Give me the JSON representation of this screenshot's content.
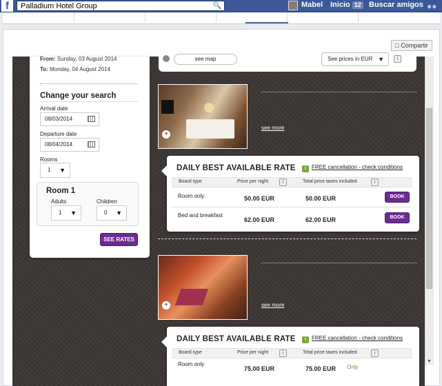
{
  "topbar": {
    "logo": "f",
    "search_value": "Palladium Hotel Group",
    "user_name": "Mabel",
    "home_label": "Inicio",
    "home_count": "12",
    "find_friends": "Buscar amigos"
  },
  "share_label": "Compartir",
  "search_panel": {
    "from_label": "From:",
    "from_value": "Sunday, 03 August 2014",
    "to_label": "To:",
    "to_value": "Monday, 04 August 2014",
    "title": "Change your search",
    "arrival_label": "Arrival date",
    "arrival_value": "08/03/2014",
    "departure_label": "Departure date",
    "departure_value": "08/04/2014",
    "rooms_label": "Rooms",
    "rooms_value": "1",
    "room_title": "Room 1",
    "adults_label": "Adults",
    "adults_value": "1",
    "children_label": "Children",
    "children_value": "0",
    "see_rates": "SEE RATES"
  },
  "map_strip": {
    "see_map": "see map",
    "prices_select": "See prices in EUR"
  },
  "rooms": [
    {
      "see_more": "see more",
      "rate_title": "DAILY BEST AVAILABLE RATE",
      "free_cancel": "FREE cancellation - check conditions",
      "headers": {
        "board": "Board type",
        "per_night": "Price per night",
        "total": "Total price taxes included"
      },
      "rows": [
        {
          "board": "Room only",
          "per_night": "50.00 EUR",
          "total": "50.00 EUR",
          "book": "BOOK"
        },
        {
          "board": "Bed and breakfast",
          "per_night": "62.00 EUR",
          "total": "62.00 EUR",
          "book": "BOOK"
        }
      ]
    },
    {
      "see_more": "see more",
      "rate_title": "DAILY BEST AVAILABLE RATE",
      "free_cancel": "FREE cancellation - check conditions",
      "headers": {
        "board": "Board type",
        "per_night": "Price per night",
        "total": "Total price taxes included"
      },
      "rows": [
        {
          "board": "Room only",
          "per_night": "75.00 EUR",
          "total": "75.00 EUR",
          "note": "Only"
        }
      ]
    }
  ]
}
